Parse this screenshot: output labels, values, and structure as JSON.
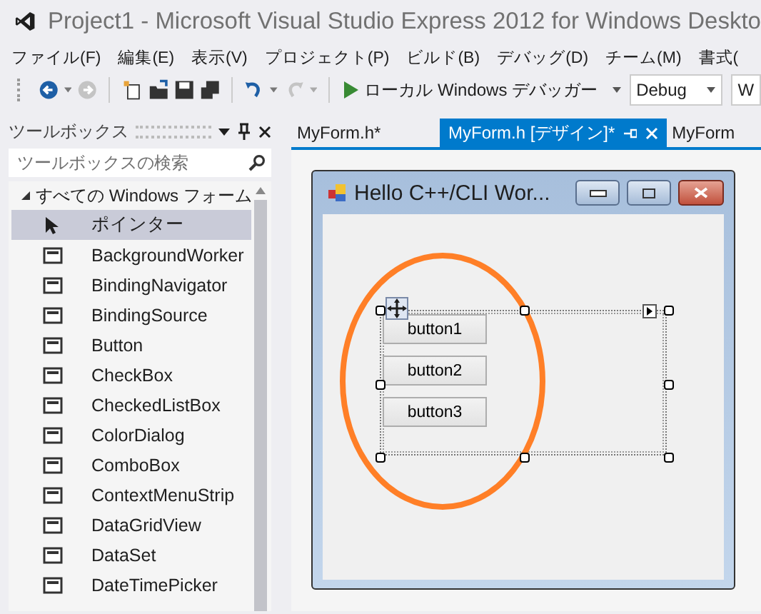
{
  "window": {
    "title": "Project1 - Microsoft Visual Studio Express 2012 for Windows Deskto"
  },
  "menu": [
    "ファイル(F)",
    "編集(E)",
    "表示(V)",
    "プロジェクト(P)",
    "ビルド(B)",
    "デバッグ(D)",
    "チーム(M)",
    "書式("
  ],
  "toolbar": {
    "run_label": "ローカル Windows デバッガー",
    "configuration": "Debug",
    "platform": "W"
  },
  "toolbox": {
    "title": "ツールボックス",
    "search": {
      "placeholder": "ツールボックスの検索"
    },
    "category": {
      "label": "すべての Windows フォーム",
      "expanded": true
    },
    "items": [
      {
        "label": "ポインター",
        "selected": true
      },
      {
        "label": "BackgroundWorker",
        "selected": false
      },
      {
        "label": "BindingNavigator",
        "selected": false
      },
      {
        "label": "BindingSource",
        "selected": false
      },
      {
        "label": "Button",
        "selected": false
      },
      {
        "label": "CheckBox",
        "selected": false
      },
      {
        "label": "CheckedListBox",
        "selected": false
      },
      {
        "label": "ColorDialog",
        "selected": false
      },
      {
        "label": "ComboBox",
        "selected": false
      },
      {
        "label": "ContextMenuStrip",
        "selected": false
      },
      {
        "label": "DataGridView",
        "selected": false
      },
      {
        "label": "DataSet",
        "selected": false
      },
      {
        "label": "DateTimePicker",
        "selected": false
      }
    ]
  },
  "tabs": [
    {
      "label": "MyForm.h*",
      "selected": false
    },
    {
      "label": "MyForm.h [デザイン]*",
      "selected": true
    },
    {
      "label": "MyForm",
      "selected": false
    }
  ],
  "form": {
    "title": "Hello C++/CLI Wor...",
    "buttons": [
      "button1",
      "button2",
      "button3"
    ]
  }
}
